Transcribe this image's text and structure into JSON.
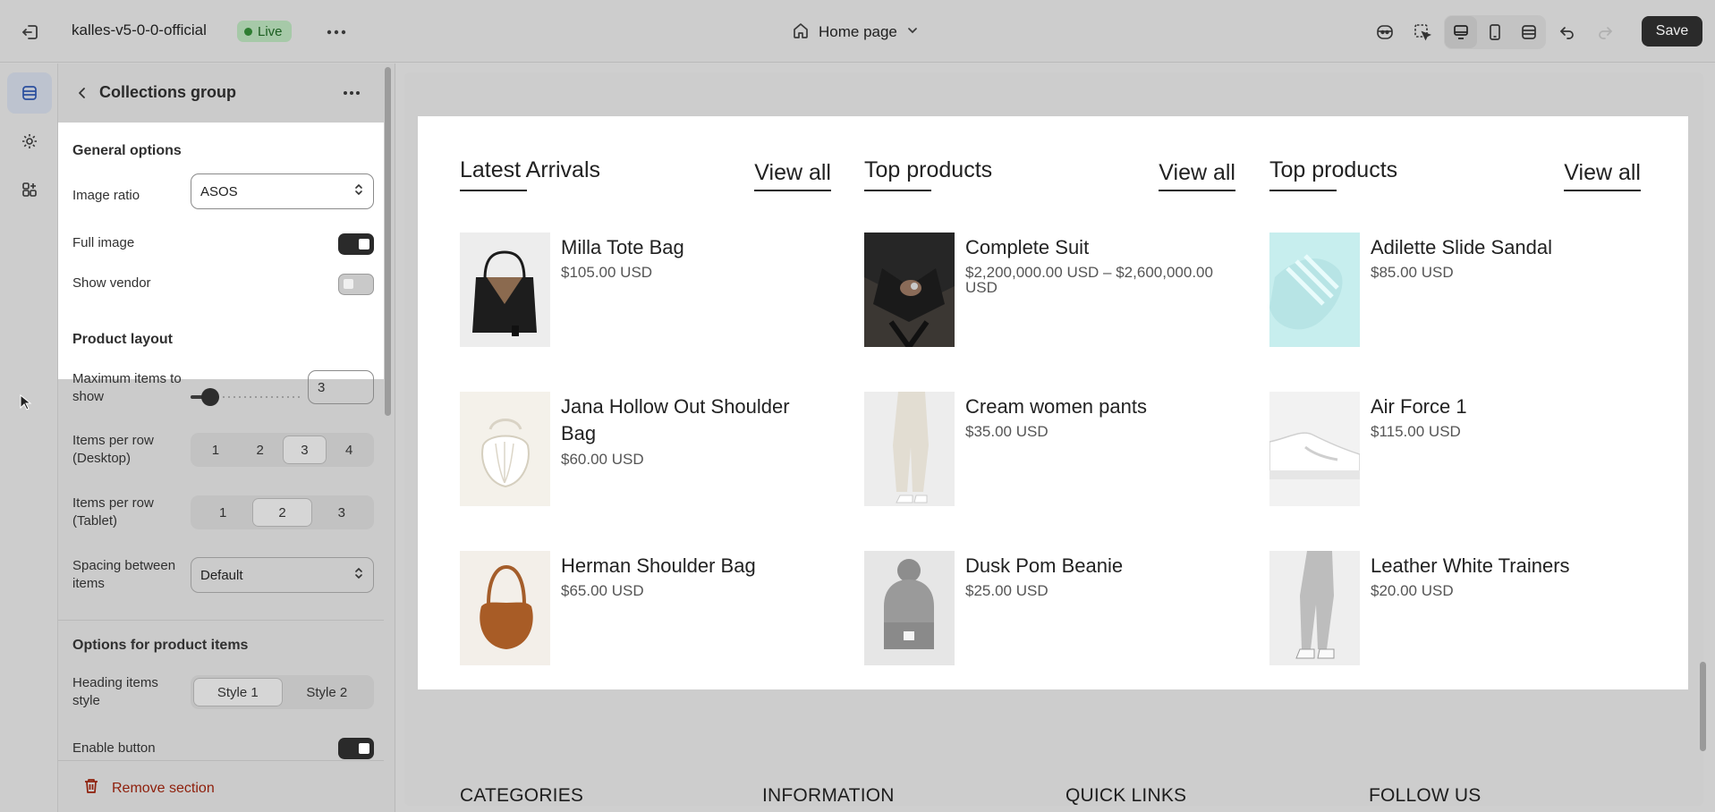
{
  "topbar": {
    "store_name": "kalles-v5-0-0-official",
    "status_badge": "Live",
    "page_selector": "Home page",
    "save_label": "Save",
    "icons": [
      "exit-icon",
      "more-icon",
      "home-icon",
      "chevron-down-icon",
      "ai-assistant-icon",
      "inspector-icon",
      "desktop-icon",
      "mobile-icon",
      "fullscreen-icon",
      "undo-icon",
      "redo-icon"
    ]
  },
  "rail": {
    "items": [
      "sections-icon",
      "settings-icon",
      "apps-icon"
    ]
  },
  "panel": {
    "title": "Collections group",
    "general": {
      "title": "General options",
      "image_ratio_label": "Image ratio",
      "image_ratio_value": "ASOS",
      "full_image_label": "Full image",
      "full_image_on": true,
      "show_vendor_label": "Show vendor",
      "show_vendor_on": false
    },
    "product_layout": {
      "title": "Product layout",
      "max_items_label": "Maximum items to show",
      "max_items_value": "3",
      "max_items_fraction": 0.15,
      "per_row_desktop_label": "Items per row (Desktop)",
      "per_row_desktop_options": [
        "1",
        "2",
        "3",
        "4"
      ],
      "per_row_desktop_selected": "3",
      "per_row_tablet_label": "Items per row (Tablet)",
      "per_row_tablet_options": [
        "1",
        "2",
        "3"
      ],
      "per_row_tablet_selected": "2",
      "spacing_label": "Spacing between items",
      "spacing_value": "Default"
    },
    "product_items": {
      "title": "Options for product items",
      "heading_style_label": "Heading items style",
      "heading_style_options": [
        "Style 1",
        "Style 2"
      ],
      "heading_style_selected": "Style 1",
      "enable_button_label": "Enable button",
      "enable_button_on": true
    },
    "remove_label": "Remove section"
  },
  "preview": {
    "columns": [
      {
        "title": "Latest Arrivals",
        "view_all": "View all",
        "products": [
          {
            "name": "Milla Tote Bag",
            "price": "$105.00 USD"
          },
          {
            "name": "Jana Hollow Out Shoulder Bag",
            "price": "$60.00 USD"
          },
          {
            "name": "Herman Shoulder Bag",
            "price": "$65.00 USD"
          }
        ]
      },
      {
        "title": "Top products",
        "view_all": "View all",
        "products": [
          {
            "name": "Complete Suit",
            "price": "$2,200,000.00 USD – $2,600,000.00 USD"
          },
          {
            "name": "Cream women pants",
            "price": "$35.00 USD"
          },
          {
            "name": "Dusk Pom Beanie",
            "price": "$25.00 USD"
          }
        ]
      },
      {
        "title": "Top products",
        "view_all": "View all",
        "products": [
          {
            "name": "Adilette Slide Sandal",
            "price": "$85.00 USD"
          },
          {
            "name": "Air Force 1",
            "price": "$115.00 USD"
          },
          {
            "name": "Leather White Trainers",
            "price": "$20.00 USD"
          }
        ]
      }
    ],
    "footer_headings": [
      "CATEGORIES",
      "INFORMATION",
      "QUICK LINKS",
      "FOLLOW US"
    ]
  }
}
